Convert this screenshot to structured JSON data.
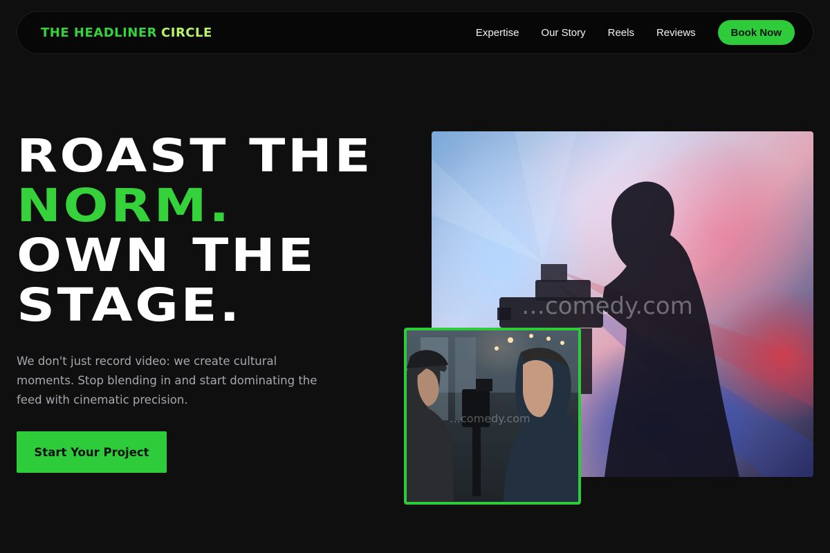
{
  "brand": {
    "name_part1": "THE HEADLINER",
    "name_part2": "CIRCLE"
  },
  "nav": {
    "links": [
      "Expertise",
      "Our Story",
      "Reels",
      "Reviews"
    ],
    "cta_label": "Book Now"
  },
  "hero": {
    "headline_line1": "ROAST THE",
    "headline_accent": "NORM.",
    "headline_line3": "OWN THE",
    "headline_line4": "STAGE.",
    "subtext": "We don't just record video: we create cultural moments. Stop blending in and start dominating the feed with cinematic precision.",
    "cta_label": "Start Your Project"
  },
  "images": {
    "main_watermark": "…comedy.com",
    "secondary_watermark": "…comedy.com"
  },
  "colors": {
    "accent_green": "#2ecc3a",
    "logo_lime": "#b8f26a",
    "background": "#0f0f10"
  }
}
